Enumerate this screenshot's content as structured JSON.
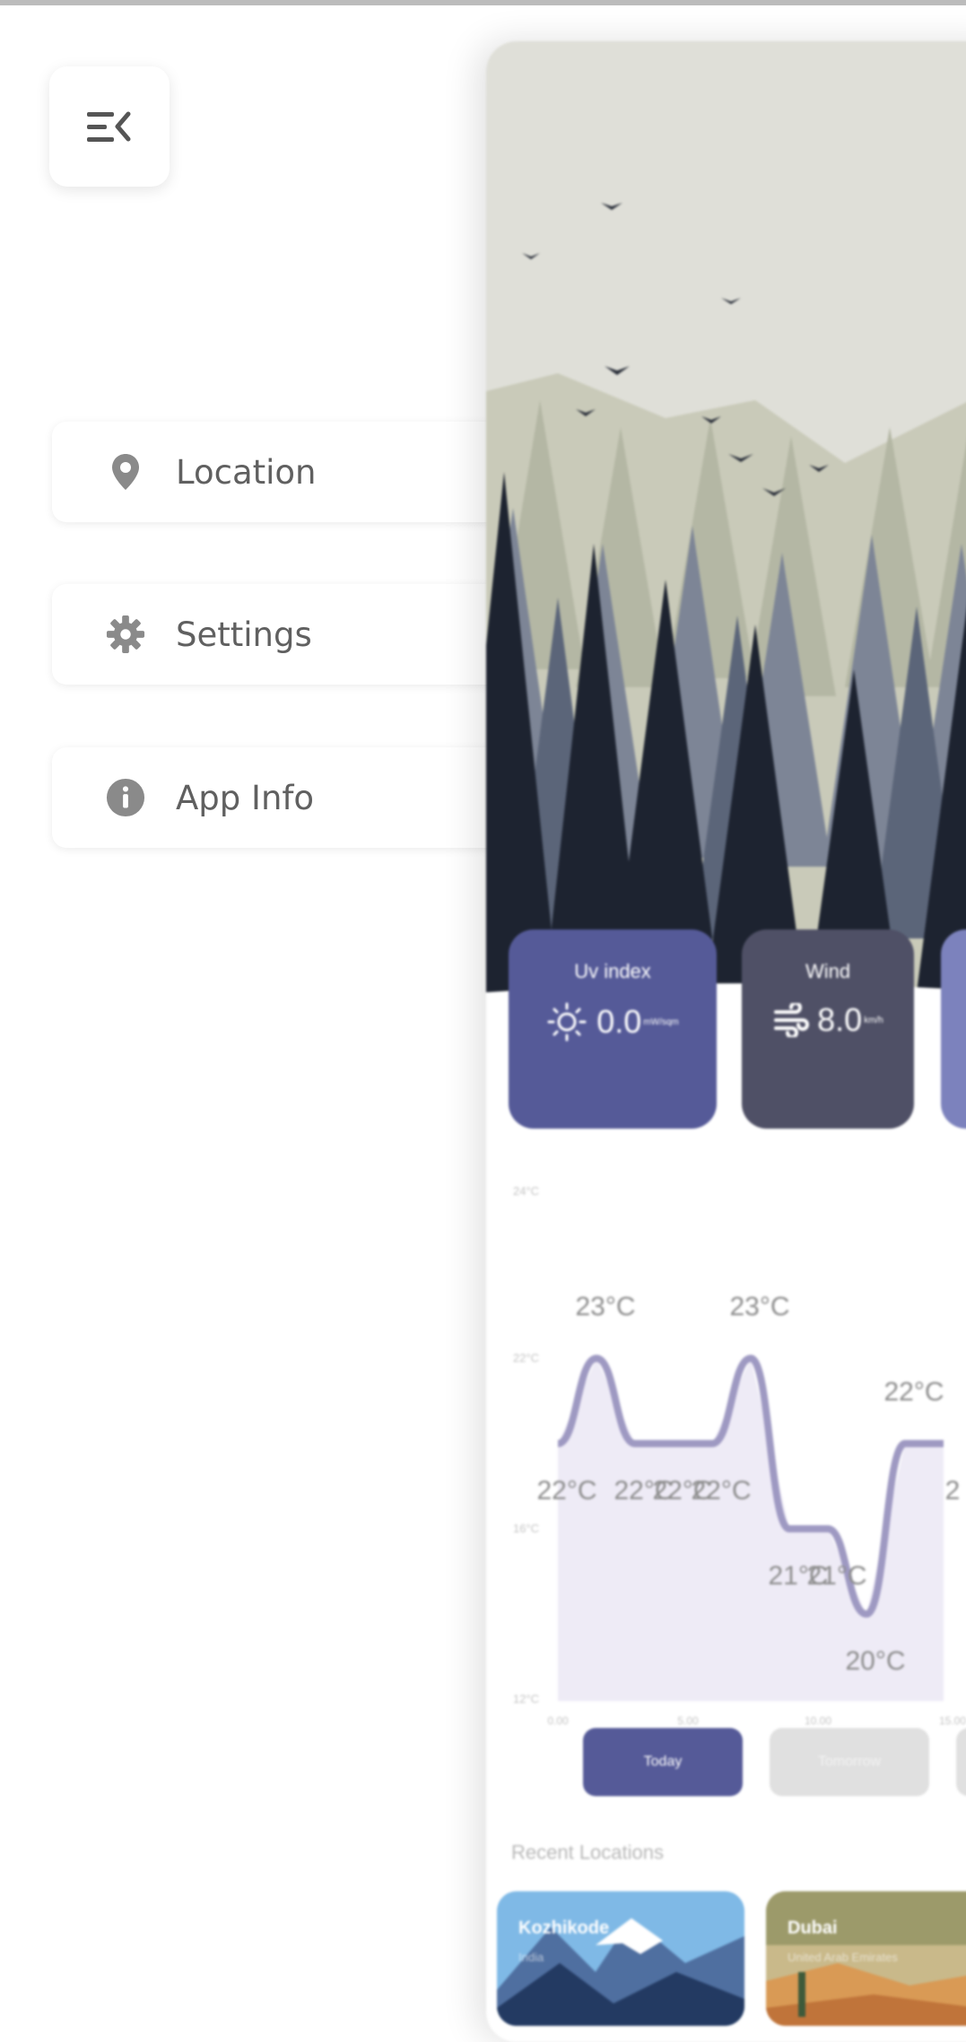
{
  "nav": {
    "items": [
      {
        "label": "Location",
        "icon": "location-pin-icon"
      },
      {
        "label": "Settings",
        "icon": "gear-icon"
      },
      {
        "label": "App Info",
        "icon": "info-icon"
      }
    ]
  },
  "stats": {
    "uv": {
      "title": "Uv index",
      "value": "0.0",
      "unit": "mW/sqm"
    },
    "wind": {
      "title": "Wind",
      "value": "8.0",
      "unit": "km/h"
    }
  },
  "colors": {
    "accent": "#555a98",
    "wind_card": "#4f5066",
    "third_card": "#7c82bd",
    "chart_line": "#9e99c2",
    "chart_fill": "#eeebf6"
  },
  "chart_data": {
    "type": "area",
    "y_ticks": [
      "24°C",
      "22°C",
      "16°C",
      "12°C"
    ],
    "x_ticks": [
      "0.00",
      "5.00",
      "10.00",
      "15.00"
    ],
    "series": [
      {
        "values": [
          22,
          23,
          22,
          22,
          22,
          23,
          21,
          21,
          20,
          22,
          22
        ]
      }
    ],
    "point_labels": [
      "22°C",
      "23°C",
      "22°C",
      "22°C",
      "22°C",
      "23°C",
      "21°C",
      "21°C",
      "20°C",
      "22°C",
      "2"
    ]
  },
  "tabs": {
    "today": "Today",
    "tomorrow": "Tomorrow"
  },
  "recent": {
    "title": "Recent Locations",
    "cards": [
      {
        "name": "Kozhikode",
        "sub": "India"
      },
      {
        "name": "Dubai",
        "sub": "United Arab Emirates"
      }
    ]
  }
}
